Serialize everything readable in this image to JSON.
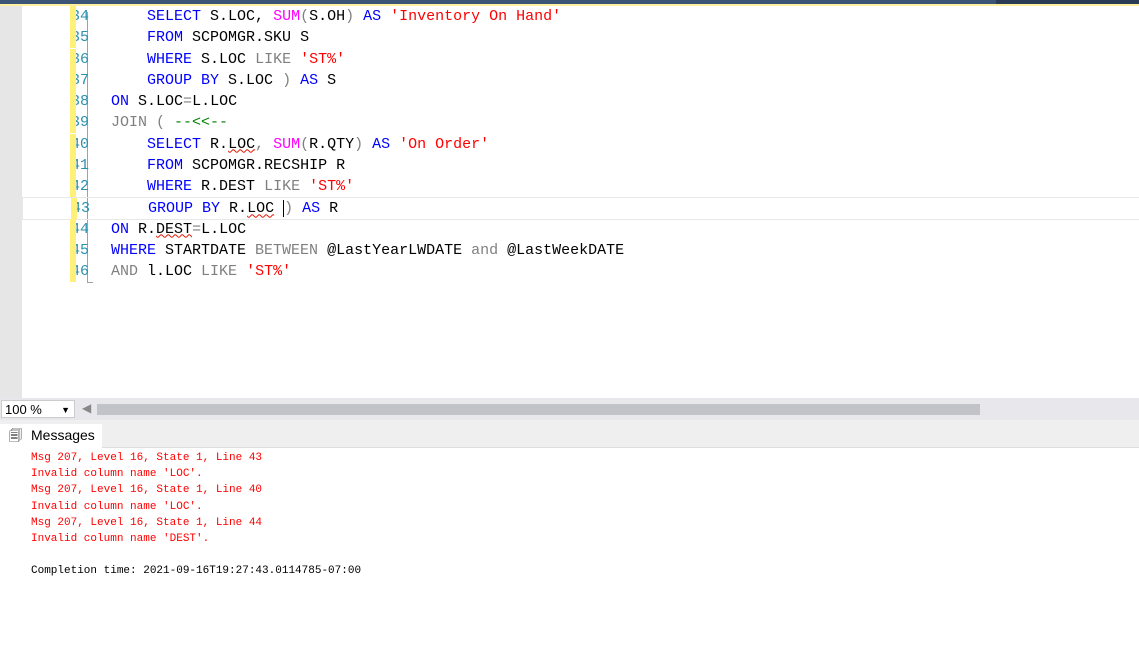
{
  "editor": {
    "lines": [
      {
        "n": "34",
        "tokens": [
          [
            "tx",
            "    "
          ],
          [
            "kw",
            "SELECT "
          ],
          [
            "tx",
            "S.LOC, "
          ],
          [
            "fn",
            "SUM"
          ],
          [
            "gr",
            "("
          ],
          [
            "tx",
            "S.OH"
          ],
          [
            "gr",
            ") "
          ],
          [
            "kw",
            "AS "
          ],
          [
            "st",
            "'Inventory On Hand'"
          ]
        ]
      },
      {
        "n": "35",
        "tokens": [
          [
            "tx",
            "    "
          ],
          [
            "kw",
            "FROM "
          ],
          [
            "tx",
            "SCPOMGR.SKU S"
          ]
        ]
      },
      {
        "n": "36",
        "tokens": [
          [
            "tx",
            "    "
          ],
          [
            "kw",
            "WHERE "
          ],
          [
            "tx",
            "S.LOC "
          ],
          [
            "gr",
            "LIKE "
          ],
          [
            "st",
            "'ST%'"
          ]
        ]
      },
      {
        "n": "37",
        "tokens": [
          [
            "tx",
            "    "
          ],
          [
            "kw",
            "GROUP BY "
          ],
          [
            "tx",
            "S.LOC "
          ],
          [
            "gr",
            ") "
          ],
          [
            "kw",
            "AS "
          ],
          [
            "tx",
            "S"
          ]
        ]
      },
      {
        "n": "38",
        "tokens": [
          [
            "kw",
            "ON "
          ],
          [
            "tx",
            "S.LOC"
          ],
          [
            "gr",
            "="
          ],
          [
            "tx",
            "L.LOC"
          ]
        ]
      },
      {
        "n": "39",
        "tokens": [
          [
            "gr",
            "JOIN ( "
          ],
          [
            "cm",
            "--<<--"
          ]
        ]
      },
      {
        "n": "40",
        "tokens": [
          [
            "tx",
            "    "
          ],
          [
            "kw",
            "SELECT "
          ],
          [
            "tx",
            "R."
          ],
          [
            "sq",
            "LOC"
          ],
          [
            "gr",
            ", "
          ],
          [
            "fn",
            "SUM"
          ],
          [
            "gr",
            "("
          ],
          [
            "tx",
            "R.QTY"
          ],
          [
            "gr",
            ") "
          ],
          [
            "kw",
            "AS "
          ],
          [
            "st",
            "'On Order'"
          ]
        ]
      },
      {
        "n": "41",
        "tokens": [
          [
            "tx",
            "    "
          ],
          [
            "kw",
            "FROM "
          ],
          [
            "tx",
            "SCPOMGR.RECSHIP R"
          ]
        ]
      },
      {
        "n": "42",
        "tokens": [
          [
            "tx",
            "    "
          ],
          [
            "kw",
            "WHERE "
          ],
          [
            "tx",
            "R.DEST "
          ],
          [
            "gr",
            "LIKE "
          ],
          [
            "st",
            "'ST%'"
          ]
        ]
      },
      {
        "n": "43",
        "tokens": [
          [
            "tx",
            "    "
          ],
          [
            "kw",
            "GROUP BY "
          ],
          [
            "tx",
            "R."
          ],
          [
            "sq",
            "LOC"
          ],
          [
            "tx",
            " "
          ],
          [
            "caret",
            ""
          ],
          [
            "gr",
            ") "
          ],
          [
            "kw",
            "AS "
          ],
          [
            "tx",
            "R"
          ]
        ]
      },
      {
        "n": "44",
        "tokens": [
          [
            "kw",
            "ON "
          ],
          [
            "tx",
            "R."
          ],
          [
            "sq",
            "DEST"
          ],
          [
            "gr",
            "="
          ],
          [
            "tx",
            "L.LOC"
          ]
        ]
      },
      {
        "n": "45",
        "tokens": [
          [
            "kw",
            "WHERE "
          ],
          [
            "tx",
            "STARTDATE "
          ],
          [
            "gr",
            "BETWEEN "
          ],
          [
            "tx",
            "@LastYearLWDATE "
          ],
          [
            "gr",
            "and "
          ],
          [
            "tx",
            "@LastWeekDATE"
          ]
        ]
      },
      {
        "n": "46",
        "tokens": [
          [
            "gr",
            "AND "
          ],
          [
            "tx",
            "l.LOC "
          ],
          [
            "gr",
            "LIKE "
          ],
          [
            "st",
            "'ST%'"
          ]
        ]
      }
    ]
  },
  "zoom": {
    "value": "100 %"
  },
  "results": {
    "tab_label": "Messages",
    "messages": [
      {
        "type": "err",
        "text": "Msg 207, Level 16, State 1, Line 43"
      },
      {
        "type": "err",
        "text": "Invalid column name 'LOC'."
      },
      {
        "type": "err",
        "text": "Msg 207, Level 16, State 1, Line 40"
      },
      {
        "type": "err",
        "text": "Invalid column name 'LOC'."
      },
      {
        "type": "err",
        "text": "Msg 207, Level 16, State 1, Line 44"
      },
      {
        "type": "err",
        "text": "Invalid column name 'DEST'."
      },
      {
        "type": "ok",
        "text": ""
      },
      {
        "type": "ok",
        "text": "Completion time: 2021-09-16T19:27:43.0114785-07:00"
      }
    ]
  }
}
